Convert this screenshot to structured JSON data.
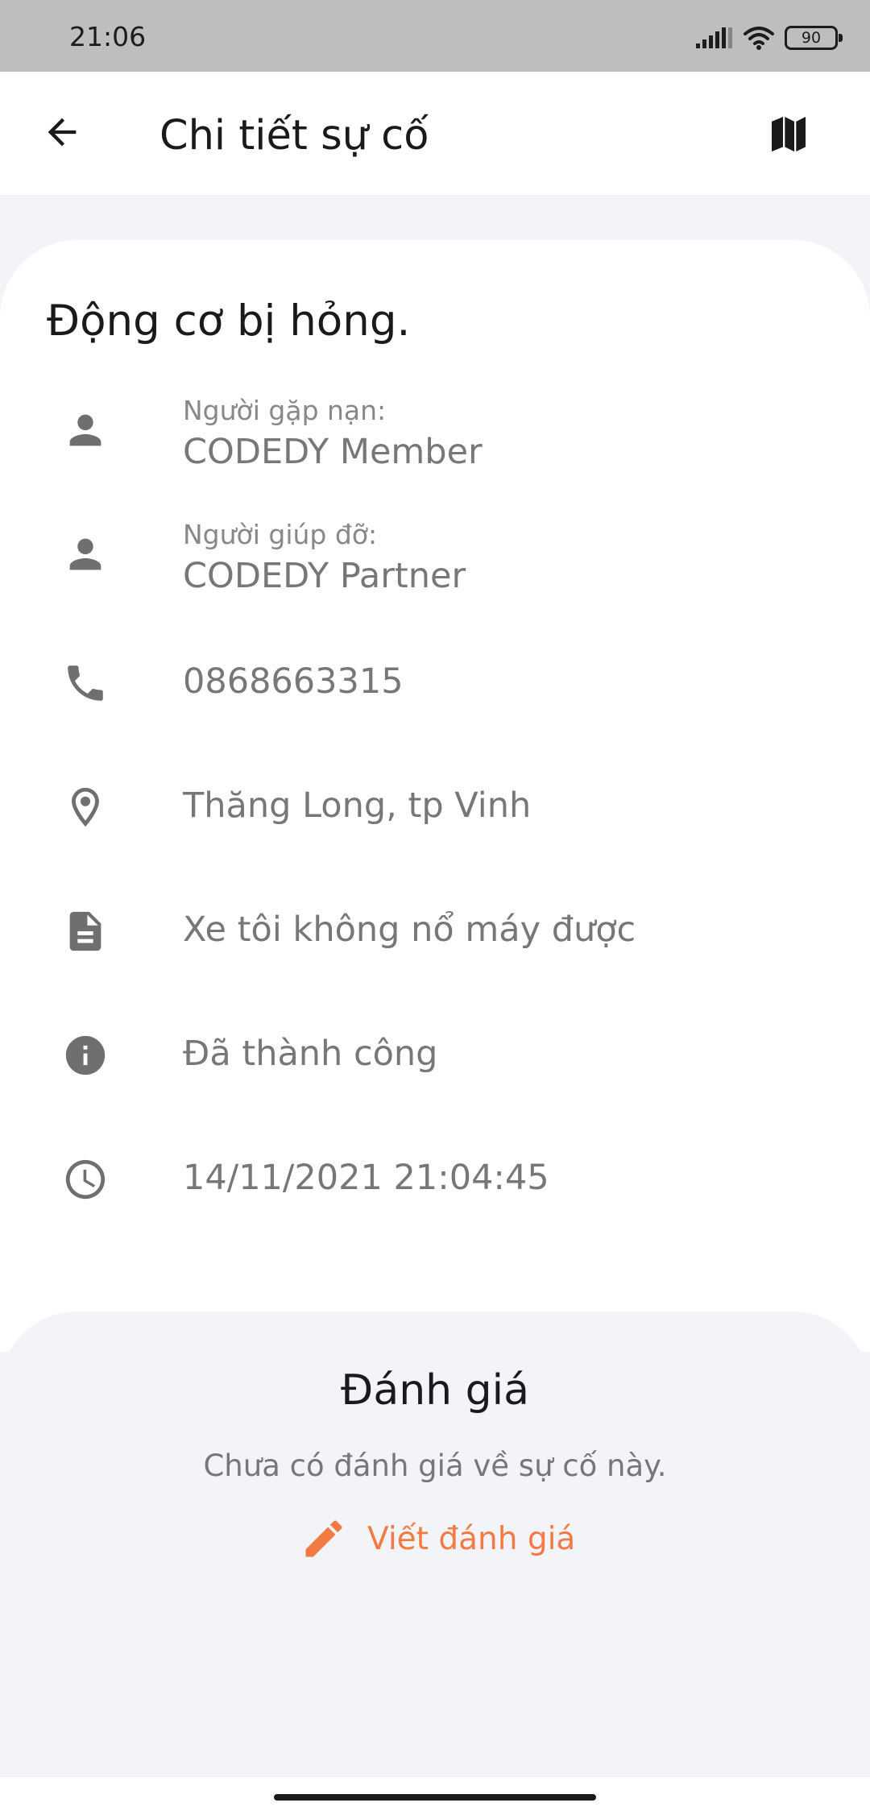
{
  "status_bar": {
    "time": "21:06",
    "battery": "90"
  },
  "app_bar": {
    "title": "Chi tiết sự cố",
    "back_icon": "arrow-back-icon",
    "map_icon": "map-icon"
  },
  "incident": {
    "title": "Động cơ bị hỏng.",
    "victim": {
      "label": "Người gặp nạn:",
      "value": "CODEDY Member",
      "icon": "person-icon"
    },
    "helper": {
      "label": "Người giúp đỡ:",
      "value": "CODEDY Partner",
      "icon": "person-icon"
    },
    "phone": {
      "value": "0868663315",
      "icon": "phone-icon"
    },
    "location": {
      "value": "Thăng Long, tp Vinh",
      "icon": "location-pin-icon"
    },
    "description": {
      "value": "Xe tôi không nổ máy được",
      "icon": "document-icon"
    },
    "status": {
      "value": "Đã thành công",
      "icon": "info-icon"
    },
    "time": {
      "value": "14/11/2021 21:04:45",
      "icon": "clock-icon"
    }
  },
  "rating": {
    "title": "Đánh giá",
    "empty_text": "Chưa có đánh giá về sự cố này.",
    "write_label": "Viết đánh giá",
    "write_icon": "pencil-icon"
  },
  "colors": {
    "accent": "#f47a45",
    "icon_gray": "#6f6f6f",
    "page_bg": "#f3f4f8"
  }
}
